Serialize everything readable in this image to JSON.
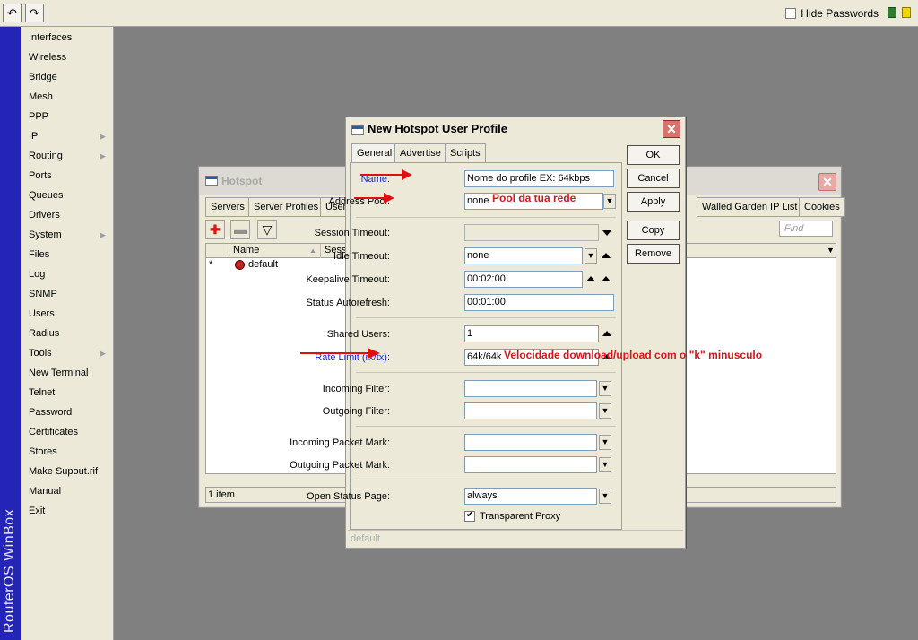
{
  "toolbar": {
    "undo_icon": "undo-icon",
    "redo_icon": "redo-icon",
    "hide_passwords_label": "Hide Passwords",
    "hide_passwords_checked": false
  },
  "sidebar": {
    "brand": "RouterOS WinBox",
    "items": [
      {
        "label": "Interfaces",
        "submenu": false
      },
      {
        "label": "Wireless",
        "submenu": false
      },
      {
        "label": "Bridge",
        "submenu": false
      },
      {
        "label": "Mesh",
        "submenu": false
      },
      {
        "label": "PPP",
        "submenu": false
      },
      {
        "label": "IP",
        "submenu": true
      },
      {
        "label": "Routing",
        "submenu": true
      },
      {
        "label": "Ports",
        "submenu": false
      },
      {
        "label": "Queues",
        "submenu": false
      },
      {
        "label": "Drivers",
        "submenu": false
      },
      {
        "label": "System",
        "submenu": true
      },
      {
        "label": "Files",
        "submenu": false
      },
      {
        "label": "Log",
        "submenu": false
      },
      {
        "label": "SNMP",
        "submenu": false
      },
      {
        "label": "Users",
        "submenu": false
      },
      {
        "label": "Radius",
        "submenu": false
      },
      {
        "label": "Tools",
        "submenu": true
      },
      {
        "label": "New Terminal",
        "submenu": false
      },
      {
        "label": "Telnet",
        "submenu": false
      },
      {
        "label": "Password",
        "submenu": false
      },
      {
        "label": "Certificates",
        "submenu": false
      },
      {
        "label": "Stores",
        "submenu": false
      },
      {
        "label": "Make Supout.rif",
        "submenu": false
      },
      {
        "label": "Manual",
        "submenu": false
      },
      {
        "label": "Exit",
        "submenu": false
      }
    ]
  },
  "hotspot_window": {
    "title": "Hotspot",
    "tabs": [
      "Servers",
      "Server Profiles",
      "User",
      "Walled Garden IP List",
      "Cookies"
    ],
    "find_placeholder": "Find",
    "columns": [
      "Name",
      "Sessi"
    ],
    "rows": [
      {
        "flag": "*",
        "name": "default"
      }
    ],
    "status": "1 item"
  },
  "dialog": {
    "title": "New Hotspot User Profile",
    "tabs": [
      "General",
      "Advertise",
      "Scripts"
    ],
    "active_tab": "General",
    "fields": {
      "name": {
        "label": "Name:",
        "value": "Nome do profile EX: 64kbps"
      },
      "address_pool": {
        "label": "Address Pool:",
        "value": "none"
      },
      "session_timeout": {
        "label": "Session Timeout:",
        "value": ""
      },
      "idle_timeout": {
        "label": "Idle Timeout:",
        "value": "none"
      },
      "keepalive_timeout": {
        "label": "Keepalive Timeout:",
        "value": "00:02:00"
      },
      "status_autorefresh": {
        "label": "Status Autorefresh:",
        "value": "00:01:00"
      },
      "shared_users": {
        "label": "Shared Users:",
        "value": "1"
      },
      "rate_limit": {
        "label": "Rate Limit (rx/tx):",
        "value": "64k/64k"
      },
      "incoming_filter": {
        "label": "Incoming Filter:",
        "value": ""
      },
      "outgoing_filter": {
        "label": "Outgoing Filter:",
        "value": ""
      },
      "incoming_packet_mark": {
        "label": "Incoming Packet Mark:",
        "value": ""
      },
      "outgoing_packet_mark": {
        "label": "Outgoing Packet Mark:",
        "value": ""
      },
      "open_status_page": {
        "label": "Open Status Page:",
        "value": "always"
      }
    },
    "transparent_proxy": {
      "label": "Transparent Proxy",
      "checked": true
    },
    "buttons": {
      "ok": "OK",
      "cancel": "Cancel",
      "apply": "Apply",
      "copy": "Copy",
      "remove": "Remove"
    },
    "status": "default"
  },
  "annotations": {
    "address_pool_note": "Pool da tua rede",
    "rate_limit_note": "Velocidade download/upload com o \"k\" minusculo",
    "arrow_color": "#e01010"
  },
  "colors": {
    "desktop": "#808080",
    "panel": "#ece9d8",
    "winbox_strip": "#2424b8",
    "link_label": "#1a2fd6"
  }
}
